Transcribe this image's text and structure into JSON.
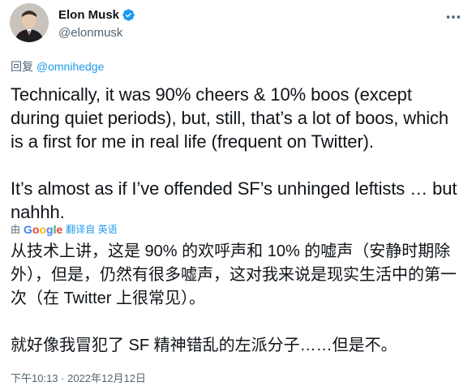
{
  "author": {
    "name": "Elon Musk",
    "handle": "@elonmusk",
    "verified": true
  },
  "reply": {
    "prefix": "回复",
    "mention": "@omnihedge"
  },
  "tweet": {
    "text": "Technically, it was 90% cheers & 10% boos (except during quiet periods), but, still, that’s a lot of boos, which is a first for me in real life (frequent on Twitter).\n\nIt’s almost as if I’ve offended SF’s unhinged leftists … but nahhh.",
    "translated_text": "从技术上讲，这是 90% 的欢呼声和 10% 的嘘声（安静时期除外），但是，仍然有很多嘘声，这对我来说是现实生活中的第一次（在 Twitter 上很常见）。\n\n就好像我冒犯了 SF 精神错乱的左派分子……但是不。"
  },
  "translation": {
    "by_prefix": "由",
    "provider": "Google",
    "translated_from_label": "翻译自 英语"
  },
  "timestamp": "下午10:13 · 2022年12月12日",
  "colors": {
    "accent": "#1d9bf0",
    "text_primary": "#0f1419",
    "text_secondary": "#536471"
  }
}
